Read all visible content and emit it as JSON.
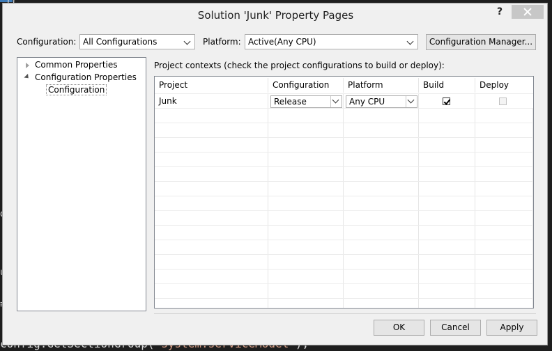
{
  "editor": {
    "top_fragment": "}}",
    "left_fragment_1": "(",
    "left_fragment_2": "d",
    "left_fragment_3": "u",
    "left_fragment_4": "≡",
    "bottom_code_plain": "config.GetSectionGroup(",
    "bottom_code_string": "\"system.serviceModel\"",
    "bottom_code_end": ");"
  },
  "dialog": {
    "title": "Solution 'Junk' Property Pages",
    "help": "?",
    "configuration_label": "Configuration:",
    "configuration_value": "All Configurations",
    "platform_label": "Platform:",
    "platform_value": "Active(Any CPU)",
    "config_manager_button": "Configuration Manager...",
    "tree": {
      "common_properties": "Common Properties",
      "configuration_properties": "Configuration Properties",
      "configuration": "Configuration"
    },
    "grid_caption": "Project contexts (check the project configurations to build or deploy):",
    "grid": {
      "columns": [
        "Project",
        "Configuration",
        "Platform",
        "Build",
        "Deploy"
      ],
      "rows": [
        {
          "project": "Junk",
          "configuration": "Release",
          "platform": "Any CPU",
          "build": true,
          "deploy": false
        }
      ]
    },
    "buttons": {
      "ok": "OK",
      "cancel": "Cancel",
      "apply": "Apply"
    }
  }
}
